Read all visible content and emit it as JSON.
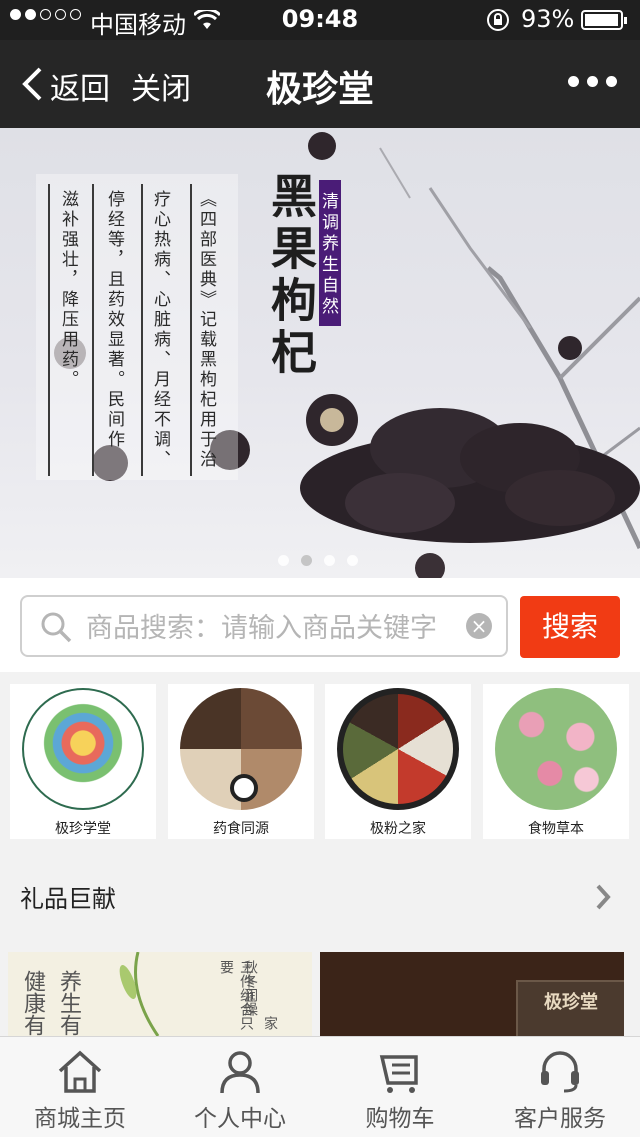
{
  "status_bar": {
    "carrier": "中国移动",
    "time": "09:48",
    "battery": "93%"
  },
  "nav": {
    "back_label": "返回",
    "close_label": "关闭",
    "title": "极珍堂"
  },
  "banner": {
    "headline": "黑果枸杞",
    "tag": "清调养生自然",
    "columns": [
      "《四部医典》记载黑枸杞用于治",
      "疗心热病、心脏病、月经不调、",
      "停经等，且药效显著。民间作",
      "滋补强壮，降压用药。"
    ],
    "slide_count": 4,
    "active_slide": 2
  },
  "search": {
    "placeholder": "商品搜索：请输入商品关键字",
    "value": "",
    "button_label": "搜索"
  },
  "categories": [
    {
      "label": "极珍学堂"
    },
    {
      "label": "药食同源"
    },
    {
      "label": "极粉之家"
    },
    {
      "label": "食物草本"
    }
  ],
  "section": {
    "title": "礼品巨献"
  },
  "products": {
    "left_text_a": "健康有",
    "left_text_b": "养生有",
    "left_text_c": "三件组合只要",
    "left_text_d": "秋冬润燥",
    "left_text_e": "家",
    "right_brand": "极珍堂"
  },
  "tabbar": [
    {
      "label": "商城主页",
      "icon": "home-icon"
    },
    {
      "label": "个人中心",
      "icon": "user-icon"
    },
    {
      "label": "购物车",
      "icon": "cart-icon"
    },
    {
      "label": "客户服务",
      "icon": "headset-icon"
    }
  ],
  "colors": {
    "accent": "#f13b14",
    "nav_bg": "#262626",
    "tag_bg": "#4a1c77"
  }
}
